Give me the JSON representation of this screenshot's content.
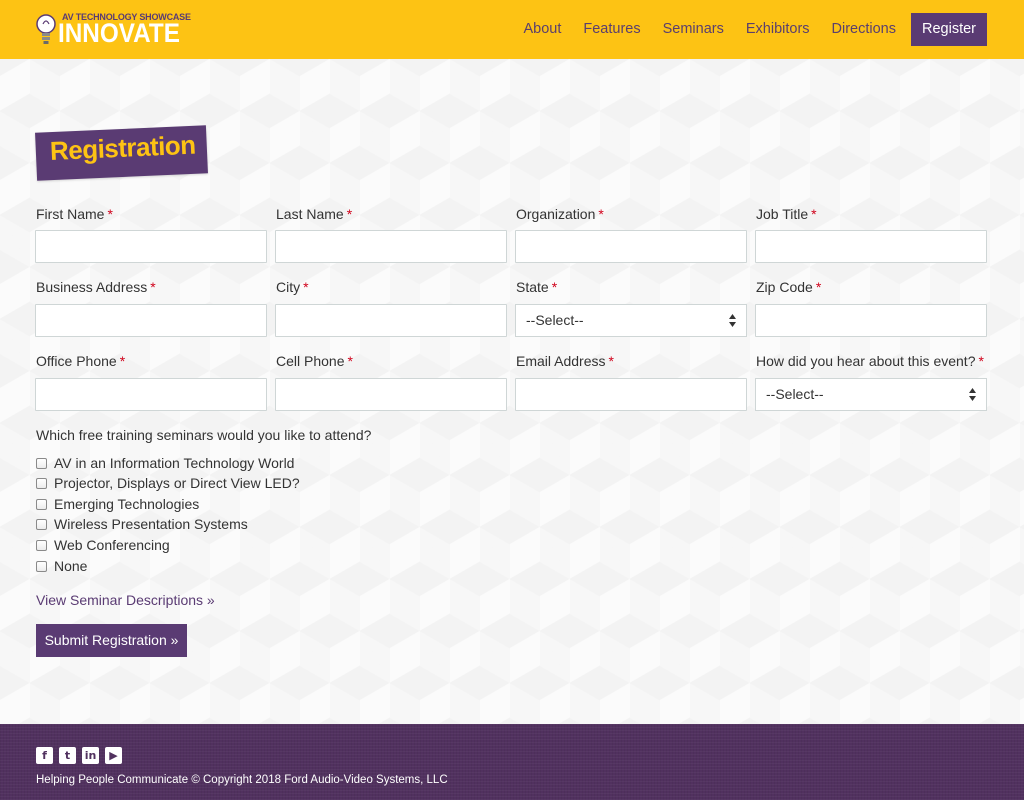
{
  "brand": {
    "tagline": "AV TECHNOLOGY SHOWCASE",
    "name": "INNOVATE",
    "logo_icon": "lightbulb-icon"
  },
  "nav": {
    "items": [
      {
        "label": "About"
      },
      {
        "label": "Features"
      },
      {
        "label": "Seminars"
      },
      {
        "label": "Exhibitors"
      },
      {
        "label": "Directions"
      }
    ],
    "register_label": "Register"
  },
  "page_title": "Registration",
  "form": {
    "required_mark": "*",
    "fields": [
      {
        "label": "First Name",
        "value": ""
      },
      {
        "label": "Last Name",
        "value": ""
      },
      {
        "label": "Organization",
        "value": ""
      },
      {
        "label": "Job Title",
        "value": ""
      },
      {
        "label": "Business Address",
        "value": ""
      },
      {
        "label": "City",
        "value": ""
      },
      {
        "label": "State",
        "selected": "--Select--"
      },
      {
        "label": "Zip Code",
        "value": ""
      },
      {
        "label": "Office Phone",
        "value": ""
      },
      {
        "label": "Cell Phone",
        "value": ""
      },
      {
        "label": "Email Address",
        "value": ""
      },
      {
        "label": "How did you hear about this event?",
        "selected": "--Select--"
      }
    ],
    "seminars_question": "Which free training seminars would you like to attend?",
    "seminars": [
      {
        "label": "AV in an Information Technology World",
        "checked": false
      },
      {
        "label": "Projector, Displays or Direct View LED?",
        "checked": false
      },
      {
        "label": "Emerging Technologies",
        "checked": false
      },
      {
        "label": "Wireless Presentation Systems",
        "checked": false
      },
      {
        "label": "Web Conferencing",
        "checked": false
      },
      {
        "label": "None",
        "checked": false
      }
    ],
    "descriptions_link": "View Seminar Descriptions »",
    "submit_label": "Submit Registration »"
  },
  "footer": {
    "social_icons": [
      "facebook-icon",
      "twitter-icon",
      "linkedin-icon",
      "youtube-icon"
    ],
    "copyright": "Helping People Communicate © Copyright 2018 Ford Audio-Video Systems, LLC"
  },
  "colors": {
    "header_bg": "#fdc314",
    "accent_purple": "#5a3b73",
    "footer_bg": "#51315f",
    "required_red": "#d0021b"
  }
}
